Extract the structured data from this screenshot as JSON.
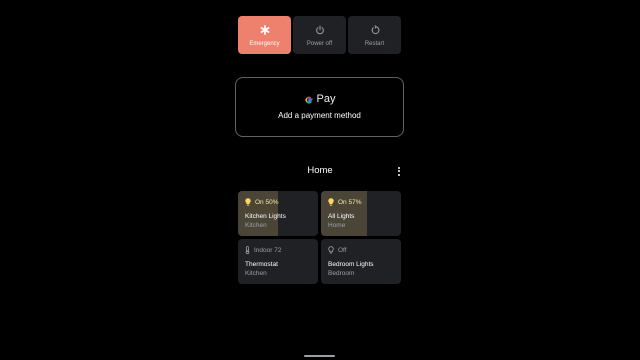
{
  "power_menu": {
    "emergency": {
      "label": "Emergency",
      "icon": "asterisk-icon",
      "color": "#ee806e"
    },
    "power_off": {
      "label": "Power off",
      "icon": "power-icon"
    },
    "restart": {
      "label": "Restart",
      "icon": "restart-icon"
    }
  },
  "gpay": {
    "logo_text": "Pay",
    "subtitle": "Add a payment method"
  },
  "home": {
    "title": "Home",
    "menu_icon": "more-vert-icon"
  },
  "devices": [
    {
      "status": "On 50%",
      "level": 0.5,
      "name": "Kitchen Lights",
      "room": "Kitchen",
      "icon": "lightbulb-icon",
      "state": "on"
    },
    {
      "status": "On 57%",
      "level": 0.57,
      "name": "All Lights",
      "room": "Home",
      "icon": "lightbulb-icon",
      "state": "on"
    },
    {
      "status": "Indoor 72",
      "name": "Thermostat",
      "room": "Kitchen",
      "icon": "thermometer-icon",
      "state": "idle"
    },
    {
      "status": "Off",
      "name": "Bedroom Lights",
      "room": "Bedroom",
      "icon": "lightbulb-outline-icon",
      "state": "off"
    }
  ],
  "colors": {
    "tile_bg": "#202124",
    "tile_fill": "#4a4536",
    "bulb_on": "#fdd663"
  }
}
